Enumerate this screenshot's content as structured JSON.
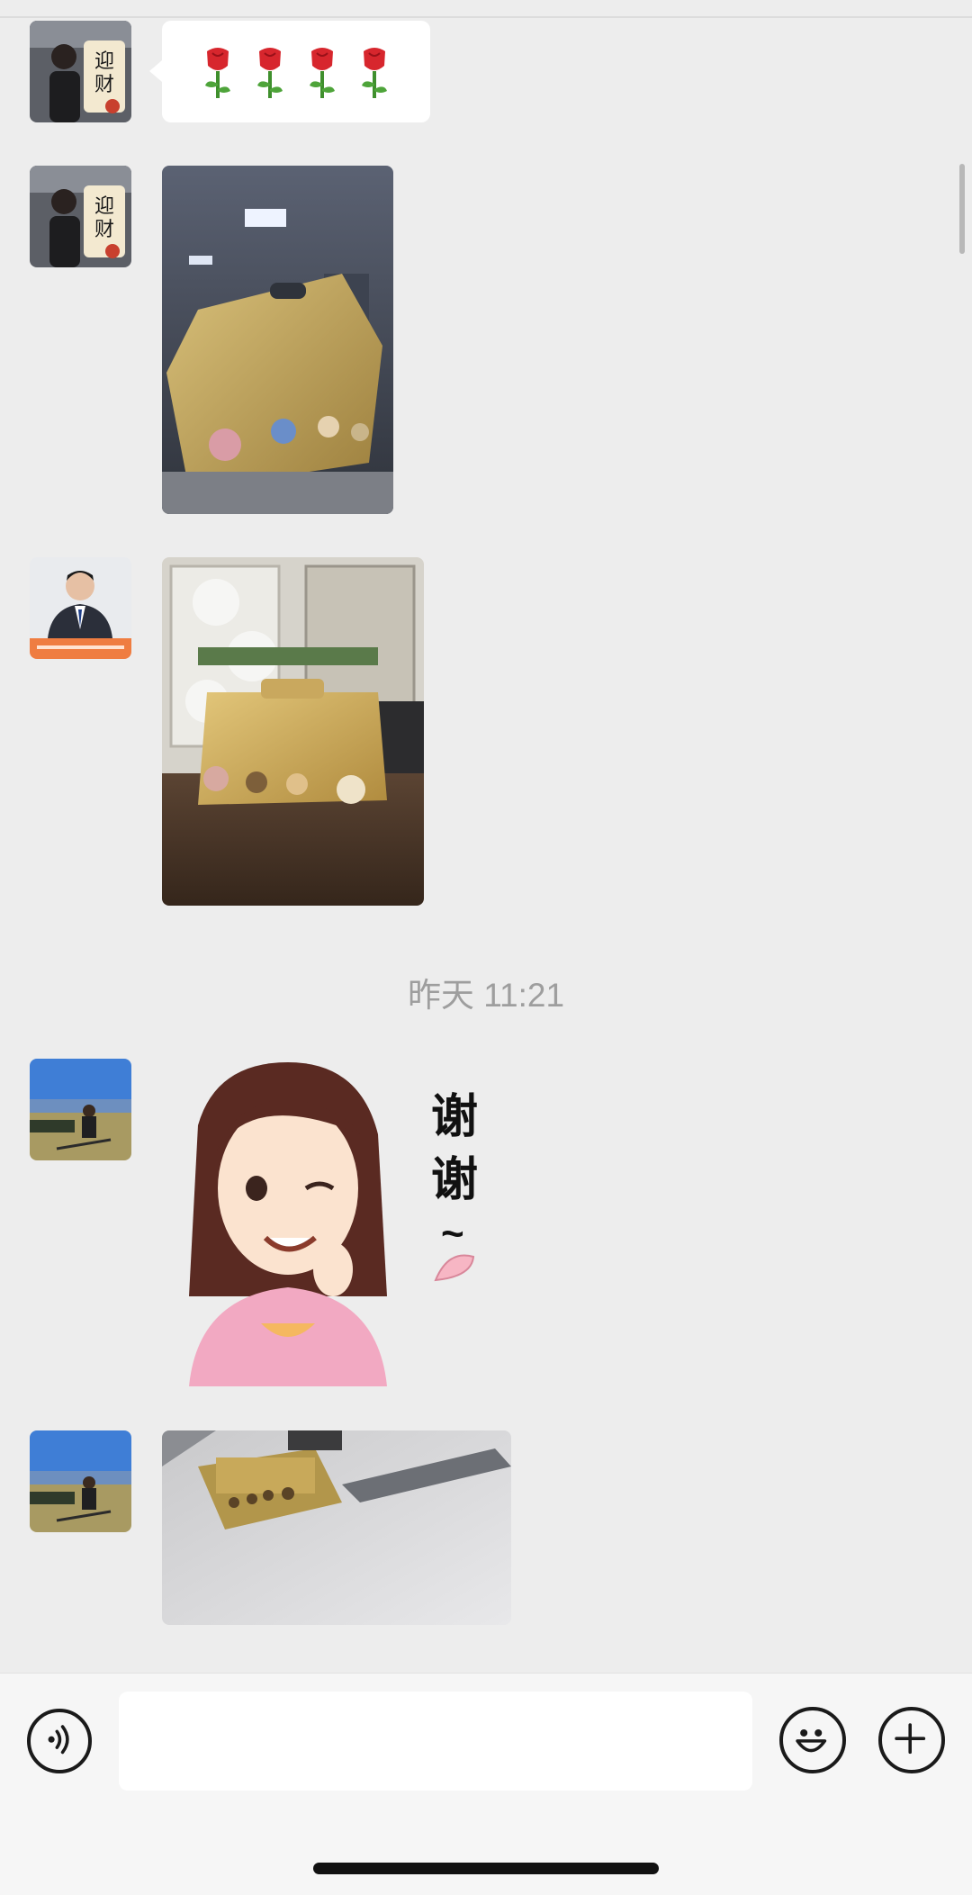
{
  "chat": {
    "timestamp": "昨天 11:21",
    "messages": [
      {
        "type": "emoji",
        "content": "🌹🌹🌹🌹",
        "sender_avatar": "avatar-woman-caishen"
      },
      {
        "type": "image",
        "description_icon": "gift-box-photo",
        "sender_avatar": "avatar-woman-caishen"
      },
      {
        "type": "image",
        "description_icon": "gift-box-on-table-photo",
        "sender_avatar": "avatar-man-suit"
      },
      {
        "type": "sticker",
        "sticker_text": "谢谢",
        "sticker_tilde": "~",
        "sender_avatar": "avatar-woman-lakeside"
      },
      {
        "type": "image",
        "description_icon": "gift-box-blurry-photo",
        "sender_avatar": "avatar-woman-lakeside"
      }
    ]
  },
  "input_bar": {
    "text_value": "",
    "voice_icon": "voice-icon",
    "emoji_icon": "emoji-face-icon",
    "plus_icon": "plus-icon"
  },
  "colors": {
    "background": "#ededed",
    "bubble": "#ffffff",
    "timestamp": "#9e9e9e"
  }
}
